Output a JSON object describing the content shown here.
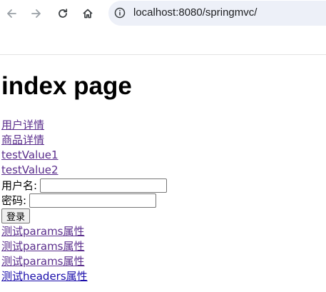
{
  "browser": {
    "url": "localhost:8080/springmvc/",
    "icons": {
      "back": "arrow-left-icon",
      "forward": "arrow-right-icon",
      "reload": "reload-icon",
      "home": "home-icon",
      "site_info": "info-circle-icon"
    },
    "colors": {
      "address_bar": "#edf0f8",
      "icon": "#5f6368",
      "icon_disabled": "#9aa0a6"
    }
  },
  "page": {
    "title": "index page",
    "links_top": [
      {
        "label": "用户详情",
        "state": "visited"
      },
      {
        "label": "商品详情",
        "state": "visited"
      },
      {
        "label": "testValue1",
        "state": "visited"
      },
      {
        "label": "testValue2",
        "state": "visited"
      }
    ],
    "form": {
      "username_label": "用户名:",
      "username_value": "",
      "password_label": "密码:",
      "password_value": "",
      "submit_label": "登录"
    },
    "links_bottom": [
      {
        "label": "测试params属性",
        "state": "visited"
      },
      {
        "label": "测试params属性",
        "state": "visited"
      },
      {
        "label": "测试params属性",
        "state": "visited"
      },
      {
        "label": "测试headers属性",
        "state": "unvisited"
      }
    ],
    "colors": {
      "visited_link": "#5a2d8c",
      "unvisited_link": "#1a0dab"
    }
  }
}
